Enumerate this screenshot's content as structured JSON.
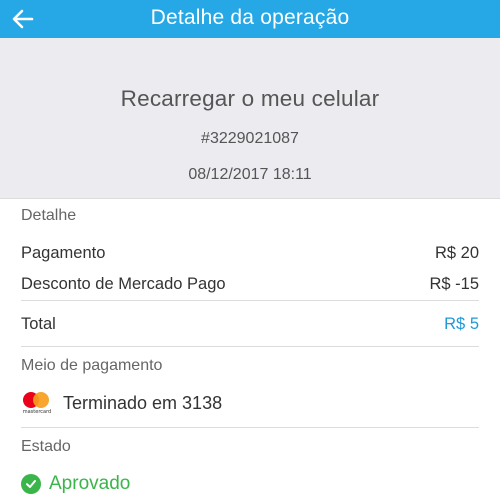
{
  "header": {
    "title": "Detalhe da operação",
    "back_icon": "arrow-left-icon"
  },
  "summary": {
    "title": "Recarregar o meu celular",
    "operation_id": "#3229021087",
    "date": "08/12/2017 18:11"
  },
  "detail": {
    "label": "Detalhe",
    "items": [
      {
        "name": "Pagamento",
        "value": "R$ 20"
      },
      {
        "name": "Desconto de Mercado Pago",
        "value": "R$ -15"
      }
    ],
    "total": {
      "name": "Total",
      "value": "R$ 5"
    }
  },
  "payment": {
    "label": "Meio de pagamento",
    "card_logo_text": "mastercard",
    "card_text": "Terminado em 3138",
    "icon": "mastercard-icon"
  },
  "status": {
    "label": "Estado",
    "value": "Aprovado",
    "icon": "check-circle-icon"
  },
  "colors": {
    "header_bg": "#26a8e6",
    "summary_bg": "#ebebf0",
    "accent": "#1f9ad6",
    "success": "#39b54a"
  }
}
